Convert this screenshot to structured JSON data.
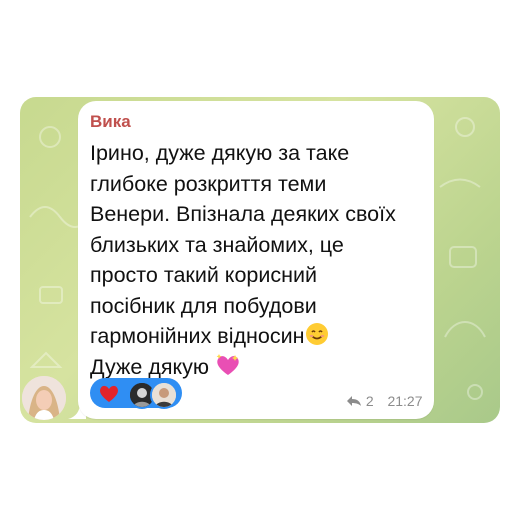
{
  "message": {
    "sender": "Вика",
    "lines": [
      "Ірино, дуже дякую за таке",
      "глибоке розкриття теми",
      "Венери. Впізнала деяких своїх",
      "близьких та знайомих, це",
      "просто такий корисний",
      "посібник для побудови",
      "гармонійних відносин",
      "Дуже дякую"
    ],
    "reply_count": "2",
    "time": "21:27"
  },
  "reactions": {
    "emoji": "heart",
    "users": [
      "user-avatar-1",
      "user-avatar-2"
    ]
  },
  "colors": {
    "sender_name": "#c0504d",
    "reaction_pill": "#2f8ef3",
    "chat_bg": "#c7d98f"
  }
}
